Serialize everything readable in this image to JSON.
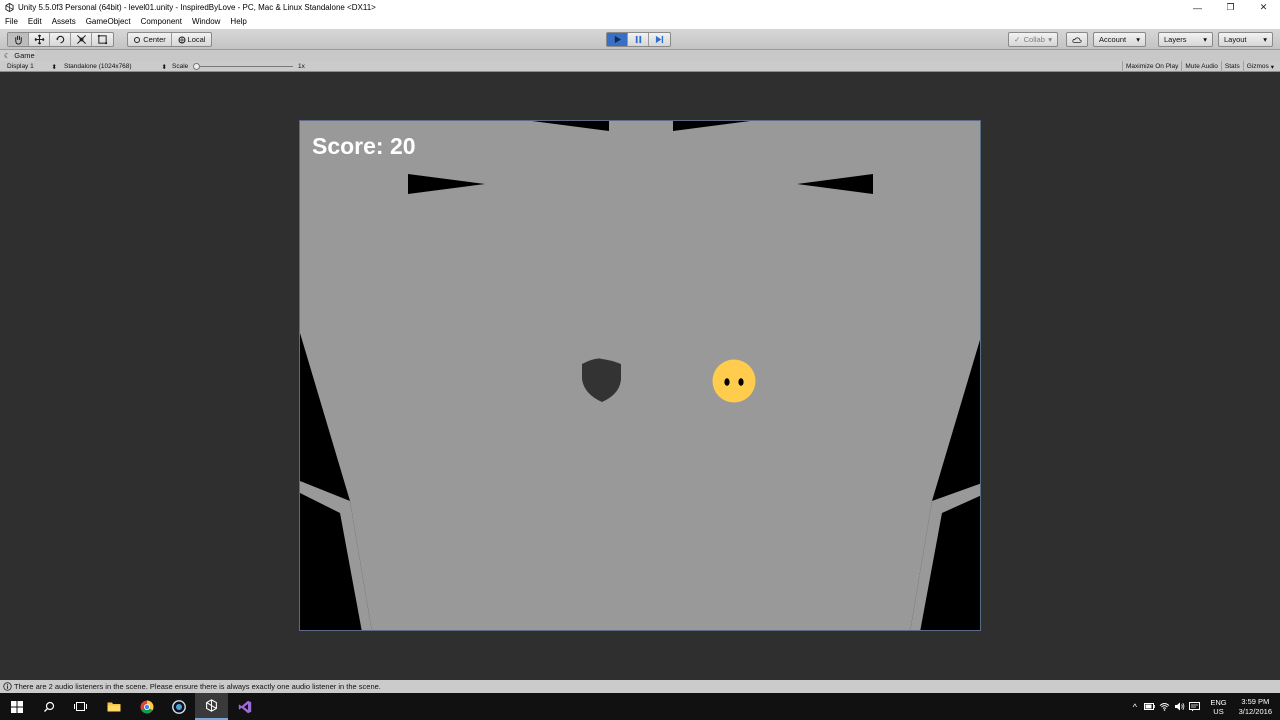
{
  "window": {
    "title": "Unity 5.5.0f3 Personal (64bit) - level01.unity - InspiredByLove - PC, Mac & Linux Standalone <DX11>",
    "minimize": "—",
    "restore": "❐",
    "close": "✕"
  },
  "menu": [
    "File",
    "Edit",
    "Assets",
    "GameObject",
    "Component",
    "Window",
    "Help"
  ],
  "toolbar": {
    "pivot_label": "Center",
    "space_label": "Local",
    "collab_label": "Collab",
    "account_label": "Account",
    "layers_label": "Layers",
    "layout_label": "Layout",
    "play_active": true,
    "accent": "#3a70c4"
  },
  "game_tab": {
    "label": "Game"
  },
  "game_bar": {
    "display": "Display 1",
    "resolution": "Standalone (1024x768)",
    "scale_label": "Scale",
    "scale_value": "1x",
    "maximize": "Maximize On Play",
    "mute": "Mute Audio",
    "stats": "Stats",
    "gizmos": "Gizmos"
  },
  "game": {
    "score_text": "Score: 20",
    "background": "#999999",
    "player_color": "#ffcc4d",
    "shield_color": "#333333"
  },
  "status": {
    "message": "There are 2 audio listeners in the scene. Please ensure there is always exactly one audio listener in the scene."
  },
  "taskbar": {
    "lang_top": "ENG",
    "lang_bottom": "US",
    "time": "3:59 PM",
    "date": "3/12/2016"
  }
}
